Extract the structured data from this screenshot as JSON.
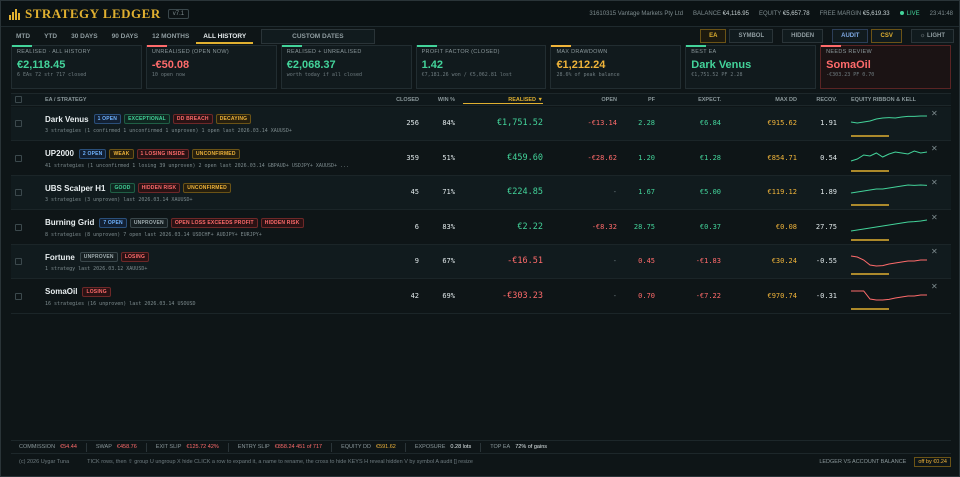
{
  "header": {
    "app_title": "STRATEGY LEDGER",
    "version": "v7.1",
    "account": "31610315 Vantage Markets Pty Ltd",
    "balance_label": "BALANCE",
    "balance": "€4,116.95",
    "equity_label": "EQUITY",
    "equity": "€5,657.78",
    "free_margin_label": "FREE MARGIN",
    "free_margin": "€5,619.33",
    "live_label": "LIVE",
    "time": "23:41:48"
  },
  "tabs": [
    "MTD",
    "YTD",
    "30 DAYS",
    "90 DAYS",
    "12 MONTHS",
    "ALL HISTORY"
  ],
  "active_tab": "ALL HISTORY",
  "custom_dates_label": "CUSTOM DATES",
  "right_tabs": {
    "ea": "EA",
    "symbol": "SYMBOL",
    "hidden": "HIDDEN",
    "audit": "AUDIT",
    "csv": "CSV",
    "light": "LIGHT"
  },
  "kpis": [
    {
      "label": "REALISED · ALL HISTORY",
      "value": "€2,118.45",
      "sub": "6 EAs  72 str  717 closed",
      "color": "pos",
      "accent": "#43d39a"
    },
    {
      "label": "UNREALISED (OPEN NOW)",
      "value": "-€50.08",
      "sub": "10 open now",
      "color": "neg",
      "accent": "#ff6b6b"
    },
    {
      "label": "REALISED + UNREALISED",
      "value": "€2,068.37",
      "sub": "worth today if all closed",
      "color": "pos",
      "accent": "#43d39a"
    },
    {
      "label": "PROFIT FACTOR (CLOSED)",
      "value": "1.42",
      "sub": "€7,181.26 won / €5,062.81 lost",
      "color": "pos",
      "accent": "#43d39a"
    },
    {
      "label": "MAX DRAWDOWN",
      "value": "€1,212.24",
      "sub": "28.6% of peak balance",
      "color": "amb",
      "accent": "#f0b43a"
    },
    {
      "label": "BEST EA",
      "value": "Dark Venus",
      "sub": "€1,751.52   PF 2.28",
      "color": "pos",
      "accent": "#43d39a"
    },
    {
      "label": "NEEDS REVIEW",
      "value": "SomaOil",
      "sub": "-€303.23   PF 0.70",
      "color": "neg",
      "accent": "#ff6b6b"
    }
  ],
  "columns": {
    "ea": "EA / STRATEGY",
    "closed": "CLOSED",
    "win": "WIN %",
    "realised": "REALISED ▼",
    "open": "OPEN",
    "pf": "PF",
    "expect": "EXPECT.",
    "maxdd": "MAX DD",
    "recov": "RECOV.",
    "ribbon": "EQUITY RIBBON & KELL"
  },
  "rows": [
    {
      "name": "Dark Venus",
      "badges": [
        [
          "1 OPEN",
          "blue"
        ],
        [
          "EXCEPTIONAL",
          "green"
        ],
        [
          "DD BREACH",
          "red"
        ],
        [
          "DECAYING",
          "amber"
        ]
      ],
      "meta": "3 strategies   (1 confirmed 1 unconfirmed 1 unproven)    1 open     last 2026.03.14     XAUUSD+",
      "closed": "256",
      "win": "84%",
      "realised": "€1,751.52",
      "realised_c": "pos",
      "open": "-€13.14",
      "open_c": "neg",
      "pf": "2.28",
      "pf_c": "pos",
      "expect": "€6.84",
      "expect_c": "pos",
      "maxdd": "€915.62",
      "maxdd_c": "amb",
      "recov": "1.91",
      "spark": [
        0.5,
        0.55,
        0.5,
        0.45,
        0.35,
        0.3,
        0.28,
        0.3,
        0.25,
        0.22,
        0.22,
        0.2,
        0.2
      ],
      "spark_color": "#43d39a"
    },
    {
      "name": "UP2000",
      "badges": [
        [
          "2 OPEN",
          "blue"
        ],
        [
          "WEAK",
          "amber"
        ],
        [
          "1 LOSING INSIDE",
          "red"
        ],
        [
          "UNCONFIRMED",
          "amber"
        ]
      ],
      "meta": "41 strategies   (1 unconfirmed 1 losing 39 unproven)    2 open     last 2026.03.14     GBPAUD+ USDJPY+ XAUUSD+ ...",
      "closed": "359",
      "win": "51%",
      "realised": "€459.60",
      "realised_c": "pos",
      "open": "-€28.62",
      "open_c": "neg",
      "pf": "1.20",
      "pf_c": "pos",
      "expect": "€1.28",
      "expect_c": "pos",
      "maxdd": "€854.71",
      "maxdd_c": "amb",
      "recov": "0.54",
      "spark": [
        0.7,
        0.6,
        0.4,
        0.45,
        0.3,
        0.5,
        0.35,
        0.25,
        0.3,
        0.35,
        0.2,
        0.3,
        0.25
      ],
      "spark_color": "#43d39a"
    },
    {
      "name": "UBS Scalper H1",
      "badges": [
        [
          "GOOD",
          "green"
        ],
        [
          "HIDDEN RISK",
          "red"
        ],
        [
          "UNCONFIRMED",
          "amber"
        ]
      ],
      "meta": "3 strategies   (3 unproven)    last 2026.03.14     XAUUSD+",
      "closed": "45",
      "win": "71%",
      "realised": "€224.85",
      "realised_c": "pos",
      "open": "-",
      "open_c": "dim",
      "pf": "1.67",
      "pf_c": "pos",
      "expect": "€5.00",
      "expect_c": "pos",
      "maxdd": "€119.12",
      "maxdd_c": "amb",
      "recov": "1.89",
      "spark": [
        0.6,
        0.55,
        0.5,
        0.45,
        0.4,
        0.4,
        0.35,
        0.3,
        0.25,
        0.2,
        0.22,
        0.2,
        0.22
      ],
      "spark_color": "#43d39a"
    },
    {
      "name": "Burning Grid",
      "badges": [
        [
          "7 OPEN",
          "blue"
        ],
        [
          "UNPROVEN",
          "gray"
        ],
        [
          "OPEN LOSS EXCEEDS PROFIT",
          "red"
        ],
        [
          "HIDDEN RISK",
          "red"
        ]
      ],
      "meta": "8 strategies   (8 unproven)    7 open     last 2026.03.14     USDCHF+ AUDJPY+ EURJPY+",
      "closed": "6",
      "win": "83%",
      "realised": "€2.22",
      "realised_c": "pos",
      "open": "-€8.32",
      "open_c": "neg",
      "pf": "28.75",
      "pf_c": "pos",
      "expect": "€0.37",
      "expect_c": "pos",
      "maxdd": "€0.08",
      "maxdd_c": "amb",
      "recov": "27.75",
      "spark": [
        0.75,
        0.7,
        0.65,
        0.6,
        0.55,
        0.5,
        0.45,
        0.4,
        0.35,
        0.3,
        0.28,
        0.25,
        0.2
      ],
      "spark_color": "#43d39a"
    },
    {
      "name": "Fortune",
      "badges": [
        [
          "UNPROVEN",
          "gray"
        ],
        [
          "LOSING",
          "red"
        ]
      ],
      "meta": "1 strategy    last 2026.03.12     XAUUSD+",
      "closed": "9",
      "win": "67%",
      "realised": "-€16.51",
      "realised_c": "neg",
      "open": "-",
      "open_c": "dim",
      "pf": "0.45",
      "pf_c": "neg",
      "expect": "-€1.83",
      "expect_c": "neg",
      "maxdd": "€30.24",
      "maxdd_c": "amb",
      "recov": "-0.55",
      "spark": [
        0.3,
        0.35,
        0.5,
        0.75,
        0.8,
        0.78,
        0.7,
        0.65,
        0.6,
        0.55,
        0.55,
        0.5,
        0.5
      ],
      "spark_color": "#ff6b6b"
    },
    {
      "name": "SomaOil",
      "badges": [
        [
          "LOSING",
          "red"
        ]
      ],
      "meta": "16 strategies   (16 unproven)    last 2026.03.14     USOUSD",
      "closed": "42",
      "win": "69%",
      "realised": "-€303.23",
      "realised_c": "neg",
      "open": "-",
      "open_c": "dim",
      "pf": "0.70",
      "pf_c": "neg",
      "expect": "-€7.22",
      "expect_c": "neg",
      "maxdd": "€970.74",
      "maxdd_c": "amb",
      "recov": "-0.31",
      "spark": [
        0.3,
        0.3,
        0.3,
        0.7,
        0.75,
        0.75,
        0.72,
        0.65,
        0.6,
        0.55,
        0.55,
        0.5,
        0.5
      ],
      "spark_color": "#ff6b6b"
    }
  ],
  "footer": {
    "commission_label": "COMMISSION",
    "commission": "€54.44",
    "swap_label": "SWAP",
    "swap": "€458.76",
    "exit_slip_label": "EXIT SLIP",
    "exit_slip": "€125.72  42%",
    "entry_slip_label": "ENTRY SLIP",
    "entry_slip": "€858.24  451 of 717",
    "equity_dd_label": "EQUITY DD",
    "equity_dd": "€591.62",
    "exposure_label": "EXPOSURE",
    "exposure": "0.28 lots",
    "top_ea_label": "TOP EA",
    "top_ea": "72% of gains",
    "copyright": "(c) 2026 Uygar Tuna",
    "hints": "TICK rows, then  ⇧ group   U ungroup   X hide      CLICK a row to expand it, a name to rename, the cross to hide        KEYS  H reveal hidden   V by symbol   A audit   [] resize",
    "ledger_label": "LEDGER VS ACCOUNT BALANCE",
    "ledger_value": "off by €0.24"
  }
}
